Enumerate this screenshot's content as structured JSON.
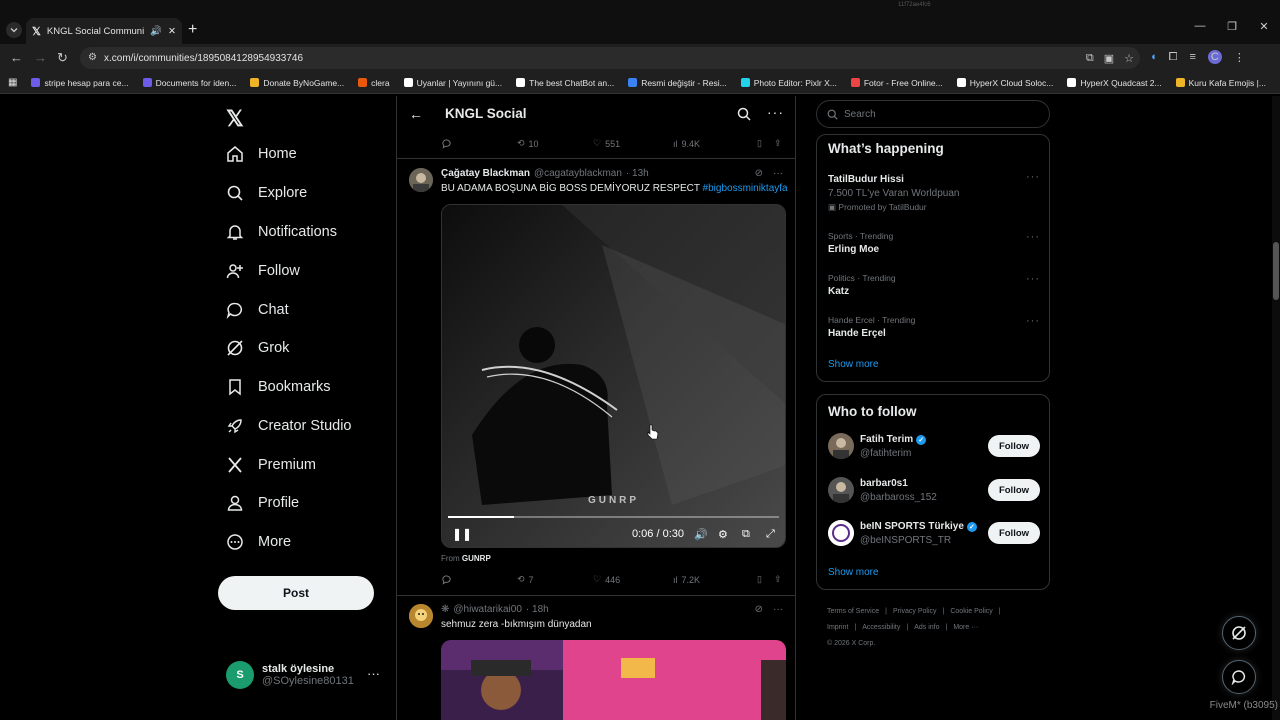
{
  "browser": {
    "tab_title": "KNGL Social Community / X",
    "url": "x.com/i/communities/1895084128954933746",
    "top_watermark": "11f72ae4fc6",
    "bookmarks": [
      {
        "label": "stripe hesap para ce...",
        "color": "#6c5ce7"
      },
      {
        "label": "Documents for iden...",
        "color": "#6c5ce7"
      },
      {
        "label": "Donate ByNoGame...",
        "color": "#f0b429"
      },
      {
        "label": "clera",
        "color": "#e8590c"
      },
      {
        "label": "Uyanlar | Yayınını gü...",
        "color": "#ffffff"
      },
      {
        "label": "The best ChatBot an...",
        "color": "#ffffff"
      },
      {
        "label": "Resmi değiştir - Resi...",
        "color": "#3b82f6"
      },
      {
        "label": "Photo Editor: Pixlr X...",
        "color": "#22d3ee"
      },
      {
        "label": "Fotor - Free Online...",
        "color": "#ef4444"
      },
      {
        "label": "HyperX Cloud Soloc...",
        "color": "#ffffff"
      },
      {
        "label": "HyperX Quadcast 2...",
        "color": "#ffffff"
      },
      {
        "label": "Kuru Kafa Emojis |...",
        "color": "#f0b429"
      }
    ],
    "profile_initial": "C"
  },
  "leftnav": {
    "items": [
      {
        "label": "Home",
        "icon": "home-icon"
      },
      {
        "label": "Explore",
        "icon": "search-icon"
      },
      {
        "label": "Notifications",
        "icon": "bell-icon"
      },
      {
        "label": "Follow",
        "icon": "person-add-icon"
      },
      {
        "label": "Chat",
        "icon": "chat-icon"
      },
      {
        "label": "Grok",
        "icon": "grok-icon"
      },
      {
        "label": "Bookmarks",
        "icon": "bookmark-icon"
      },
      {
        "label": "Creator Studio",
        "icon": "rocket-icon"
      },
      {
        "label": "Premium",
        "icon": "x-icon"
      },
      {
        "label": "Profile",
        "icon": "profile-icon"
      },
      {
        "label": "More",
        "icon": "more-circle-icon"
      }
    ],
    "post_label": "Post",
    "account": {
      "initial": "S",
      "name": "stalk öylesine",
      "handle": "@SOylesine80131"
    }
  },
  "center": {
    "title": "KNGL Social",
    "prev_tweet_stats": {
      "replies": "",
      "retweets": "10",
      "likes": "551",
      "views": "9.4K"
    },
    "tweet1": {
      "name": "Çağatay Blackman",
      "handle": "@cagatayblackman",
      "time": "· 13h",
      "text": "BU ADAMA BOŞUNA BİG BOSS DEMİYORUZ RESPECT ",
      "hashtag": "#bigbossminiktayfa",
      "video_label": "GUNRP",
      "video_time": "0:06 / 0:30",
      "progress": 0.2,
      "from_prefix": "From ",
      "from_source": "GUNRP",
      "stats": {
        "replies": "",
        "retweets": "7",
        "likes": "446",
        "views": "7.2K"
      }
    },
    "tweet2": {
      "handle": "@hiwatarikai00",
      "time": "· 18h",
      "text": "sehmuz zera -bıkmışım dünyadan"
    }
  },
  "right": {
    "search_placeholder": "Search",
    "happening_title": "What’s happening",
    "trends": [
      {
        "context": "",
        "name": "TatilBudur Hissi",
        "sub": "7.500 TL'ye Varan Worldpuan",
        "promo": "Promoted by TatilBudur"
      },
      {
        "context": "Sports · Trending",
        "name": "Erling Moe",
        "sub": "",
        "promo": ""
      },
      {
        "context": "Politics · Trending",
        "name": "Katz",
        "sub": "",
        "promo": ""
      },
      {
        "context": "Hande Ercel · Trending",
        "name": "Hande Erçel",
        "sub": "",
        "promo": ""
      }
    ],
    "show_more": "Show more",
    "wtf_title": "Who to follow",
    "who_to_follow": [
      {
        "name": "Fatih Terim",
        "handle": "@fatihterim",
        "verified": true,
        "button": "Follow"
      },
      {
        "name": "barbar0s1",
        "handle": "@barbaross_152",
        "verified": false,
        "button": "Follow"
      },
      {
        "name": "beIN SPORTS Türkiye",
        "handle": "@beINSPORTS_TR",
        "verified": true,
        "button": "Follow"
      }
    ],
    "show_more_2": "Show more",
    "footer_links": [
      "Terms of Service",
      "|",
      "Privacy Policy",
      "|",
      "Cookie Policy",
      "|",
      "Imprint",
      "|",
      "Accessibility",
      "|",
      "Ads info",
      "|",
      "More ···"
    ],
    "copyright": "© 2026 X Corp."
  },
  "overlay_watermark": "FiveM* (b3095)"
}
